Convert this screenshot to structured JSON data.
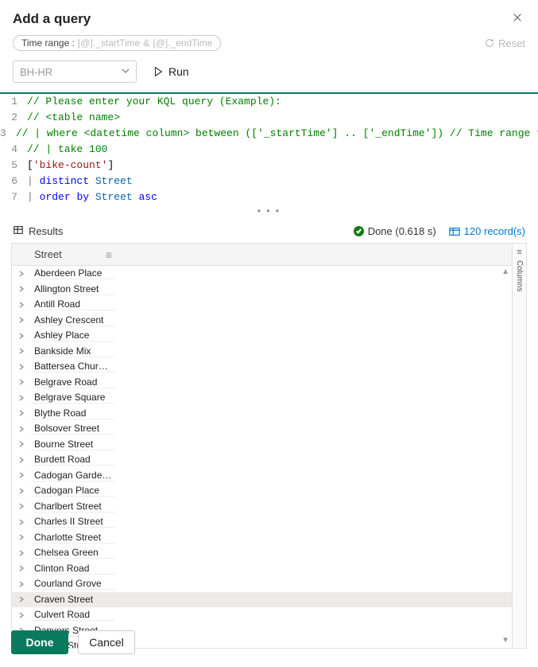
{
  "header": {
    "title": "Add a query"
  },
  "timebar": {
    "label": "Time range :",
    "start_token": "[@]._startTime",
    "sep": "&",
    "end_token": "[@]._endTime",
    "reset_label": "Reset"
  },
  "controls": {
    "dropdown_value": "BH-HR",
    "run_label": "Run"
  },
  "code_lines": [
    {
      "n": 1,
      "tokens": [
        {
          "t": "// Please enter your KQL query (Example):",
          "c": "c-comment"
        }
      ]
    },
    {
      "n": 2,
      "tokens": [
        {
          "t": "// <table name>",
          "c": "c-comment"
        }
      ]
    },
    {
      "n": 3,
      "tokens": [
        {
          "t": "// | where <datetime column> between (['_startTime'] .. ['_endTime']) // Time range filtering",
          "c": "c-comment"
        }
      ]
    },
    {
      "n": 4,
      "tokens": [
        {
          "t": "// | take 100",
          "c": "c-comment"
        }
      ]
    },
    {
      "n": 5,
      "tokens": [
        {
          "t": "[",
          "c": ""
        },
        {
          "t": "'bike-count'",
          "c": "c-string"
        },
        {
          "t": "]",
          "c": ""
        }
      ]
    },
    {
      "n": 6,
      "tokens": [
        {
          "t": "| ",
          "c": "c-pipe"
        },
        {
          "t": "distinct",
          "c": "c-key"
        },
        {
          "t": " ",
          "c": ""
        },
        {
          "t": "Street",
          "c": "c-ident"
        }
      ]
    },
    {
      "n": 7,
      "tokens": [
        {
          "t": "| ",
          "c": "c-pipe"
        },
        {
          "t": "order",
          "c": "c-key"
        },
        {
          "t": " ",
          "c": ""
        },
        {
          "t": "by",
          "c": "c-key"
        },
        {
          "t": " ",
          "c": ""
        },
        {
          "t": "Street",
          "c": "c-ident"
        },
        {
          "t": " ",
          "c": ""
        },
        {
          "t": "asc",
          "c": "c-key"
        }
      ]
    }
  ],
  "results": {
    "tab_label": "Results",
    "done_label": "Done (0.618 s)",
    "record_count_label": "120 record(s)",
    "column_header": "Street",
    "columns_panel_label": "Columns",
    "rows": [
      "Aberdeen Place",
      "Allington Street",
      "Antill Road",
      "Ashley Crescent",
      "Ashley Place",
      "Bankside Mix",
      "Battersea Church Road",
      "Belgrave Road",
      "Belgrave Square",
      "Blythe Road",
      "Bolsover Street",
      "Bourne Street",
      "Burdett Road",
      "Cadogan Gardens",
      "Cadogan Place",
      "Charlbert Street",
      "Charles II Street",
      "Charlotte Street",
      "Chelsea Green",
      "Clinton Road",
      "Courland Grove",
      "Craven Street",
      "Culvert Road",
      "Danvers Street",
      "Denyer Street"
    ],
    "selected_index": 21
  },
  "footer": {
    "done_label": "Done",
    "cancel_label": "Cancel"
  }
}
